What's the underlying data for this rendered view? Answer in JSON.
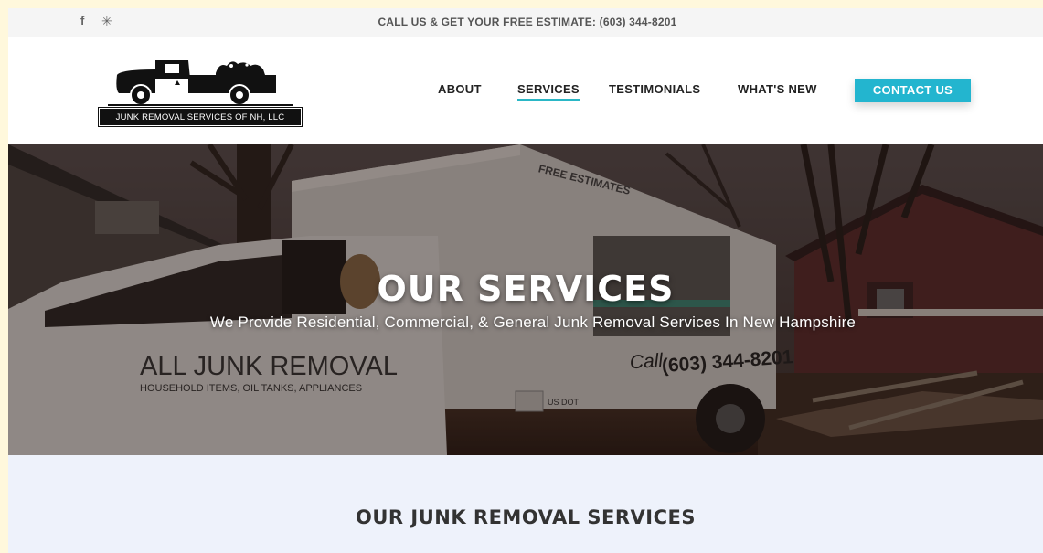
{
  "topbar": {
    "social": [
      {
        "name": "facebook-icon",
        "glyph": "f"
      },
      {
        "name": "yelp-icon",
        "glyph": "✳"
      }
    ],
    "phone_text": "CALL US & GET YOUR FREE ESTIMATE: (603) 344-8201"
  },
  "header": {
    "logo_text": "JUNK REMOVAL SERVICES OF NH, LLC",
    "nav": [
      {
        "label": "ABOUT",
        "active": false
      },
      {
        "label": "SERVICES",
        "active": true
      },
      {
        "label": "TESTIMONIALS",
        "active": false
      },
      {
        "label": "WHAT'S NEW",
        "active": false
      }
    ],
    "contact_label": "CONTACT US"
  },
  "hero": {
    "title": "OUR SERVICES",
    "subtitle": "We Provide Residential, Commercial, & General Junk Removal Services In New Hampshire",
    "truck_text": {
      "line1": "ALL JUNK REMOVAL",
      "line2": "HOUSEHOLD ITEMS, OIL TANKS, APPLIANCES",
      "phone": "(603) 344-8201",
      "call": "Call",
      "estimates": "FREE ESTIMATES",
      "dot": "US DOT"
    }
  },
  "section": {
    "title": "OUR JUNK REMOVAL SERVICES"
  },
  "colors": {
    "accent": "#23b5cf",
    "nav_underline": "#2ab7c6",
    "section_bg": "#eef2fb"
  }
}
